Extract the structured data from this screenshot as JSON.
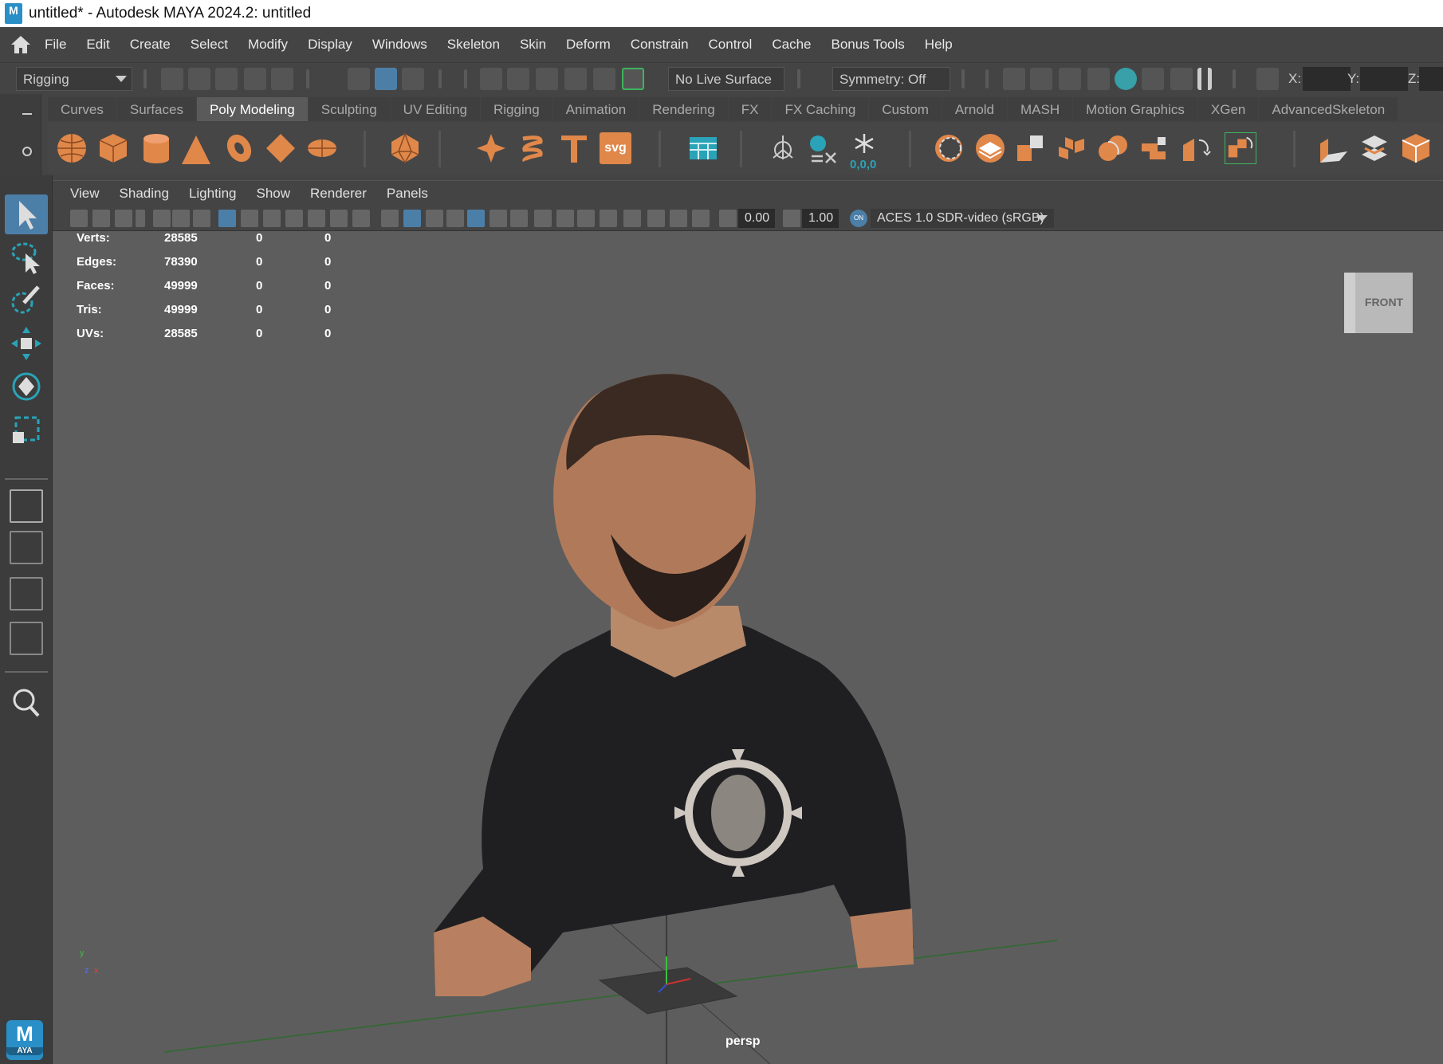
{
  "window": {
    "title": "untitled* - Autodesk MAYA 2024.2: untitled",
    "logo": "M"
  },
  "menubar": {
    "items": [
      "File",
      "Edit",
      "Create",
      "Select",
      "Modify",
      "Display",
      "Windows",
      "Skeleton",
      "Skin",
      "Deform",
      "Constrain",
      "Control",
      "Cache",
      "Bonus Tools",
      "Help"
    ]
  },
  "statusline": {
    "menuset": "Rigging",
    "live_surface": "No Live Surface",
    "symmetry": "Symmetry: Off",
    "x_label": "X:",
    "y_label": "Y:",
    "z_label": "Z:"
  },
  "shelf": {
    "tabs": [
      "Curves",
      "Surfaces",
      "Poly Modeling",
      "Sculpting",
      "UV Editing",
      "Rigging",
      "Animation",
      "Rendering",
      "FX",
      "FX Caching",
      "Custom",
      "Arnold",
      "MASH",
      "Motion Graphics",
      "XGen",
      "AdvancedSkeleton"
    ],
    "active_tab": "Poly Modeling",
    "svg_label": "svg",
    "snap_label": "0,0,0",
    "accent": "#e0874a"
  },
  "panel": {
    "menus": [
      "View",
      "Shading",
      "Lighting",
      "Show",
      "Renderer",
      "Panels"
    ],
    "exposure": "0.00",
    "gamma": "1.00",
    "colorspace": "ACES 1.0 SDR-video (sRGB)",
    "on_badge": "ON"
  },
  "hud": {
    "rows": [
      {
        "label": "Verts:",
        "v1": "28585",
        "v2": "0",
        "v3": "0"
      },
      {
        "label": "Edges:",
        "v1": "78390",
        "v2": "0",
        "v3": "0"
      },
      {
        "label": "Faces:",
        "v1": "49999",
        "v2": "0",
        "v3": "0"
      },
      {
        "label": "Tris:",
        "v1": "49999",
        "v2": "0",
        "v3": "0"
      },
      {
        "label": "UVs:",
        "v1": "28585",
        "v2": "0",
        "v3": "0"
      }
    ]
  },
  "viewport": {
    "camera": "persp",
    "viewcube_face": "FRONT",
    "axis_y": "y",
    "axis_z": "z",
    "axis_x": "x"
  },
  "brand": {
    "logo_letter": "M",
    "logo_sub": "AYA"
  }
}
